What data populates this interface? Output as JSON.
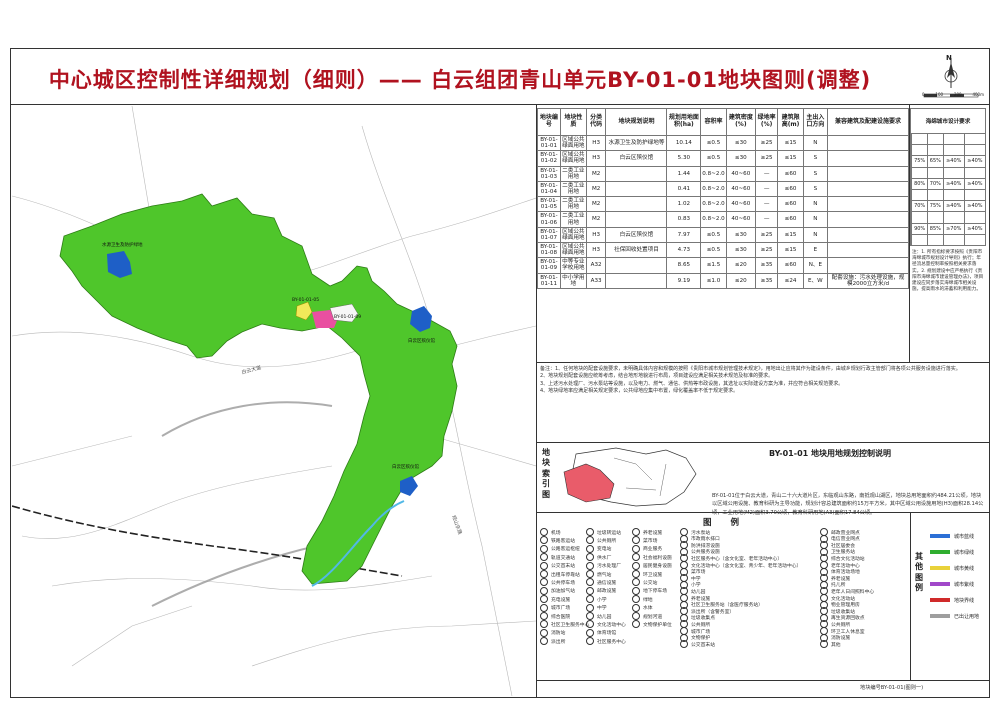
{
  "title": "中心城区控制性详细规划（细则）—— 白云组团青山单元BY-01-01地块图则(调整)",
  "compass_label": "N",
  "scale_labels": [
    "0",
    "100",
    "200",
    "400m"
  ],
  "table": {
    "headers": [
      "地块编号",
      "地块性质",
      "分类代码",
      "地块规划说明",
      "规划用地面积(ha)",
      "容积率",
      "建筑密度(%)",
      "绿地率(%)",
      "建筑限高(m)",
      "主出入口方向",
      "兼容建筑及配建设施要求"
    ],
    "rows": [
      [
        "BY-01-01-01",
        "区域公共绿面用地",
        "H3",
        "水源卫生及防护绿地等",
        "10.14",
        "≤0.5",
        "≤30",
        "≥25",
        "≤15",
        "N",
        ""
      ],
      [
        "BY-01-01-02",
        "区域公共绿面用地",
        "H3",
        "白云区殡仪馆",
        "5.30",
        "≤0.5",
        "≤30",
        "≥25",
        "≤15",
        "S",
        ""
      ],
      [
        "BY-01-01-03",
        "二类工业用地",
        "M2",
        "",
        "1.44",
        "0.8~2.0",
        "40~60",
        "—",
        "≤60",
        "S",
        ""
      ],
      [
        "BY-01-01-04",
        "二类工业用地",
        "M2",
        "",
        "0.41",
        "0.8~2.0",
        "40~60",
        "—",
        "≤60",
        "S",
        ""
      ],
      [
        "BY-01-01-05",
        "二类工业用地",
        "M2",
        "",
        "1.02",
        "0.8~2.0",
        "40~60",
        "—",
        "≤60",
        "N",
        ""
      ],
      [
        "BY-01-01-06",
        "二类工业用地",
        "M2",
        "",
        "0.83",
        "0.8~2.0",
        "40~60",
        "—",
        "≤60",
        "N",
        ""
      ],
      [
        "BY-01-01-07",
        "区域公共绿面用地",
        "H3",
        "白云区殡仪馆",
        "7.97",
        "≤0.5",
        "≤30",
        "≥25",
        "≤15",
        "N",
        ""
      ],
      [
        "BY-01-01-08",
        "区域公共绿面用地",
        "H3",
        "社保回收处置项目",
        "4.73",
        "≤0.5",
        "≤30",
        "≥25",
        "≤15",
        "E",
        ""
      ],
      [
        "BY-01-01-09",
        "中等专业学校用地",
        "A32",
        "",
        "8.65",
        "≤1.5",
        "≤20",
        "≥35",
        "≤60",
        "N、E",
        ""
      ],
      [
        "BY-01-01-11",
        "中小学用地",
        "A33",
        "",
        "9.19",
        "≤1.0",
        "≤20",
        "≥35",
        "≤24",
        "E、W",
        "配套设施：污水处理设施，规模2000立方米/d"
      ]
    ]
  },
  "index_table": {
    "header": "海绵城市设计要求",
    "rows": [
      [
        "",
        "",
        "",
        "",
        ""
      ],
      [
        "",
        "",
        "",
        "",
        ""
      ],
      [
        "",
        "75%",
        "65%",
        "≥40%",
        "≥40%"
      ],
      [
        "",
        "",
        "",
        "",
        ""
      ],
      [
        "",
        "80%",
        "70%",
        "≥40%",
        "≥40%"
      ],
      [
        "",
        "",
        "",
        "",
        ""
      ],
      [
        "",
        "70%",
        "75%",
        "≥40%",
        "≥40%"
      ],
      [
        "",
        "",
        "",
        "",
        ""
      ],
      [
        "",
        "90%",
        "85%",
        "≥70%",
        "≥40%"
      ],
      [
        "",
        "",
        "",
        "",
        ""
      ]
    ]
  },
  "right_notes": "注：1. 所有指标要求按照《贵阳市海绵城市规划设计导则》执行；年径流总量控制率按照相关要求落实。2. 规划建设中应严格执行《贵阳市海绵城市建设管理办法》，项目建设应同步落实海绵城市相关设施，提高雨水的滞蓄和利用能力。",
  "main_notes": [
    "备注：1、任何地块的配套设施要求，未明确具体内容和规模的按照《贵阳市城市规划管理技术规定》，用地出让应将其作为建设条件，由城乡规划行政主管部门将各项公共服务设施进行落实。",
    "2、地块规划配套设施应统筹考虑，结合地形地貌进行布局，项目建设应满足相关技术规范及标准的要求。",
    "3、上述污水处理厂、污水泵站等设施，以及电力、燃气、通信、供热等市政设施，其选址以实际建设方案为准，并应符合相关规范要求。",
    "4、地块绿地率应满足相关规定要求，公共绿地应集中布置，绿化覆盖率不低于规定要求。"
  ],
  "index_map_label": "地块索引图",
  "description": {
    "title": "BY-01-01 地块用地规划控制说明",
    "text": "BY-01-01位于白云大道，青山二十六大道片区，东临观山东路，南抵观山湖区，地块总用地面积约484.21公顷，地块以区域公用设施、教育科研为主导功能，规划计容总建筑面积约15万平方米，其中区域公用设施用地(H3)面积28.14公顷，工业用地(M2)面积3.70公顷，教育科研用地(A3)面积17.84公顷。"
  },
  "legend_title": "图 例",
  "legend_items": [
    "机场",
    "铁路客运站",
    "公路客运枢纽",
    "轨道交通站",
    "公交首末站",
    "出租车停靠站",
    "公共停车场",
    "加油加气站",
    "充电设施",
    "城市广场",
    "综合医院",
    "社区卫生服务中心",
    "消防站",
    "派出所",
    "垃圾转运站",
    "公共厕所",
    "变电站",
    "供水厂",
    "污水处理厂",
    "燃气站",
    "通信设施",
    "邮政设施",
    "小学",
    "中学",
    "幼儿园",
    "文化活动中心",
    "体育场馆",
    "社区服务中心",
    "养老设施",
    "菜市场",
    "商业服务",
    "社会福利设施",
    "居民健身设施",
    "环卫设施",
    "公交站",
    "地下停车场",
    "绿地",
    "水体",
    "规划河道",
    "文物保护单位"
  ],
  "legend_mid_items": [
    "污水泵站",
    "市政雨水排口",
    "防洪排涝设施",
    "公共服务设施",
    "社区服务中心（含文化室、老年活动中心）",
    "文化活动中心（含文化室、青少年、老年活动中心）",
    "菜市场",
    "中学",
    "小学",
    "幼儿园",
    "养老设施",
    "社区卫生服务站（含医疗服务站）",
    "派出所（含警务室）",
    "垃圾收集点",
    "公共厕所",
    "城市广场",
    "文物保护",
    "公交首末站"
  ],
  "legend_right_items": [
    "邮政营业网点",
    "电信营业网点",
    "社区居委会",
    "卫生服务站",
    "综合文化活动站",
    "老年活动中心",
    "体育活动场地",
    "养老设施",
    "托儿所",
    "老年人日间照料中心",
    "文化活动站",
    "物业管理用房",
    "垃圾收集站",
    "再生资源回收点",
    "公共厕所",
    "环卫工人休息室",
    "消防设施",
    "其他"
  ],
  "other_legend_title": "其他图例",
  "other_legend": [
    {
      "label": "城市蓝线",
      "color": "#2b6fd6"
    },
    {
      "label": "城市绿线",
      "color": "#2fae2f"
    },
    {
      "label": "城市黄线",
      "color": "#e9d23a"
    },
    {
      "label": "城市紫线",
      "color": "#a148c9"
    },
    {
      "label": "地块界线",
      "color": "#d02a2a"
    },
    {
      "label": "已出让用地",
      "color": "#9e9e9e"
    }
  ],
  "footer": "地块编号BY-01-01(图则一)",
  "colors": {
    "green": "#4fc62b",
    "water": "#1e5fc7",
    "pink": "#e94fa0",
    "yellow": "#f2e95a",
    "title_red": "#b0121f"
  },
  "map_labels": {
    "parcel_01": "水源卫生及防护绿地",
    "parcel_mid": "BY-01-01-05",
    "parcel_pink": "BY-01-01-09",
    "parcel_02": "白云区殡仪馆",
    "parcel_07": "白云区殡仪馆",
    "road_a": "白云大道",
    "road_b": "观山东路"
  }
}
